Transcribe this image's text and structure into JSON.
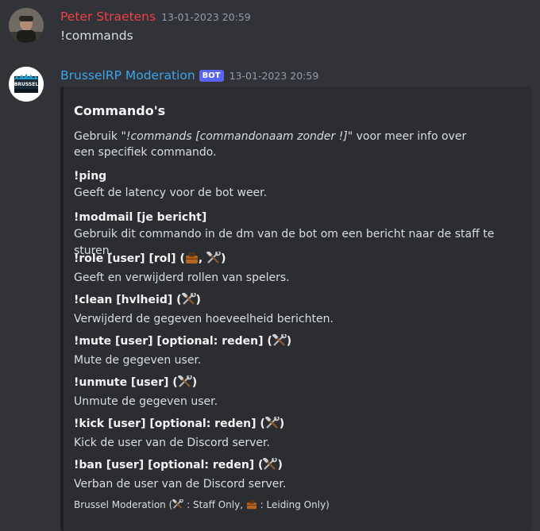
{
  "message1": {
    "author": "Peter Straetens",
    "author_color": "#ed4245",
    "timestamp": "13-01-2023 20:59",
    "content": "!commands"
  },
  "message2": {
    "author": "BrusselRP Moderation",
    "author_color": "#3ba5e9",
    "badge": "BOT",
    "timestamp": "13-01-2023 20:59",
    "avatar_text": "BRUSSEL",
    "embed": {
      "title": "Commando's",
      "description_prefix": "Gebruik ",
      "description_italic": "\"!commands [commandonaam zonder !]\"",
      "description_suffix": " voor meer info over een specifiek commando.",
      "fields": [
        {
          "name": "!ping",
          "value": "Geeft de latency voor de bot weer.",
          "emojis": []
        },
        {
          "name": "!modmail [je bericht]",
          "value": "Gebruik dit commando in de dm van de bot om een bericht naar de staff te sturen.",
          "emojis": []
        },
        {
          "name": "!role [user] [rol]",
          "value": "Geeft en verwijderd rollen van spelers.",
          "emojis": [
            "briefcase-icon",
            "hammer-wrench-icon"
          ]
        },
        {
          "name": "!clean [hvlheid]",
          "value": "Verwijderd de gegeven hoeveelheid berichten.",
          "emojis": [
            "hammer-wrench-icon"
          ]
        },
        {
          "name": "!mute [user] [optional: reden]",
          "value": "Mute de gegeven user.",
          "emojis": [
            "hammer-wrench-icon"
          ]
        },
        {
          "name": "!unmute [user]",
          "value": "Unmute de gegeven user.",
          "emojis": [
            "hammer-wrench-icon"
          ]
        },
        {
          "name": "!kick [user] [optional: reden]",
          "value": "Kick de user van de Discord server.",
          "emojis": [
            "hammer-wrench-icon"
          ]
        },
        {
          "name": "!ban [user] [optional: reden]",
          "value": "Verban de user van de Discord server.",
          "emojis": [
            "hammer-wrench-icon"
          ]
        }
      ],
      "footer": {
        "prefix": "Brussel Moderation (",
        "staff_label": " : Staff Only, ",
        "leiding_label": " : Leiding Only)"
      }
    }
  },
  "colors": {
    "background": "#313338",
    "embed_bg": "#2b2d31",
    "bot_badge": "#5865f2"
  }
}
